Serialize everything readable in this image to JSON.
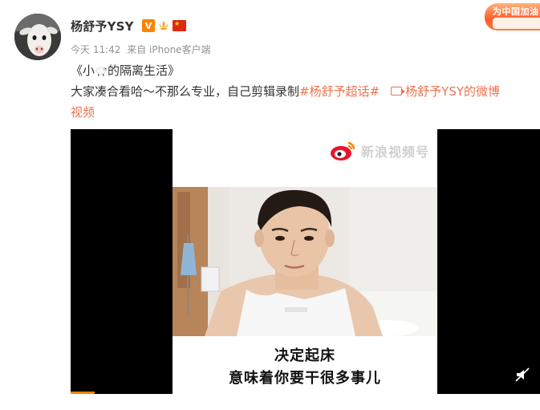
{
  "post": {
    "username": "杨舒予YSY",
    "meta": {
      "time": "今天 11:42",
      "source": "来自 iPhone客户端"
    },
    "title_pre": "《小",
    "title_post": "的隔离生活》",
    "body_text": "大家凑合看哈～不那么专业，自己剪辑录制",
    "topic": "#杨舒予超话#",
    "video_link": "杨舒予YSY的微博",
    "video_link_tail": "视频"
  },
  "badges": {
    "verified": "V"
  },
  "promo": {
    "text": "为中国加油"
  },
  "video": {
    "watermark": "新浪视频号",
    "subtitle_line1": "决定起床",
    "subtitle_line2": "意味着你要干很多事儿"
  },
  "colors": {
    "topic": "#eb7350",
    "username": "#333333",
    "meta": "#939393",
    "verified": "#ff8200",
    "progress": "#ff8200"
  },
  "icons": [
    "sheep-avatar-icon",
    "verified-icon",
    "lotus-icon",
    "china-flag-icon",
    "sheep-emoji-icon",
    "video-link-icon",
    "weibo-logo-icon",
    "mute-icon"
  ]
}
